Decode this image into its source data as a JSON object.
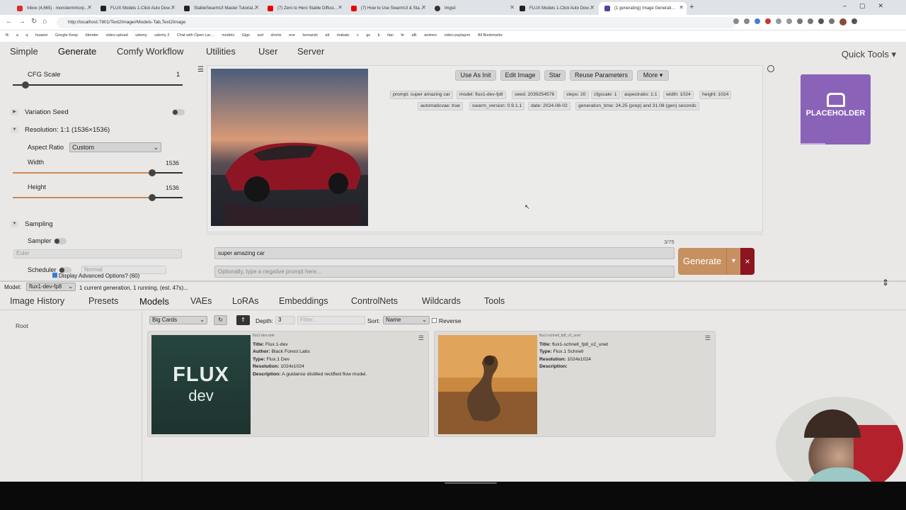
{
  "browser": {
    "tabs": [
      {
        "title": "Inbox (4,665) - monstermmorp…",
        "color": "#d93025"
      },
      {
        "title": "FLUX Models 1-Click Auto Dow…",
        "color": "#222"
      },
      {
        "title": "StableSwarmUI Master Tutorial…",
        "color": "#222"
      },
      {
        "title": "(7) Zero to Hero Stable Diffusi…",
        "color": "#e00"
      },
      {
        "title": "(7) How to Use SwarmUI & Sta…",
        "color": "#e00"
      },
      {
        "title": "Imgsli",
        "color": "#333"
      },
      {
        "title": "FLUX Models 1-Click Auto Dow…",
        "color": "#222"
      },
      {
        "title": "(1 generating) Image Generati…",
        "color": "#5a3fa0"
      }
    ],
    "url": "http://localhost:7801/Text2Image#Models-Tab,Text2Image",
    "bookmarks": [
      "fk",
      "a",
      "q",
      "huawei",
      "Google Keep",
      "blender",
      "video upload",
      "udemy",
      "udemy 2",
      "Chat with Open Lar…",
      "models",
      "Gigs",
      "ssd",
      "shorts",
      "eve",
      "leonardo",
      "alt",
      "makale",
      "c",
      "gs",
      "b",
      "ilan",
      "fe",
      "afk",
      "animex",
      "video paylaşım",
      "All Bookmarks"
    ]
  },
  "nav": {
    "tabs": [
      "Simple",
      "Generate",
      "Comfy Workflow",
      "Utilities",
      "User",
      "Server"
    ],
    "active": "Generate",
    "quick_tools": "Quick Tools"
  },
  "params": {
    "cfg_label": "CFG Scale",
    "cfg_value": "1",
    "variation_label": "Variation Seed",
    "resolution_label": "Resolution: 1:1 (1536×1536)",
    "aspect_label": "Aspect Ratio",
    "aspect_value": "Custom",
    "width_label": "Width",
    "width_value": "1536",
    "height_label": "Height",
    "height_value": "1536",
    "sampling_label": "Sampling",
    "sampler_label": "Sampler",
    "sampler_value": "Euler",
    "scheduler_label": "Scheduler",
    "scheduler_value": "Normal",
    "display_advanced": "Display Advanced Options? (60)"
  },
  "image_actions": [
    "Use As Init",
    "Edit Image",
    "Star",
    "Reuse Parameters",
    "More ▾"
  ],
  "metadata_row1": [
    "prompt: super amazing car",
    "model: flux1-dev-fp8",
    "seed: 2039254576",
    "steps: 20",
    "cfgscale: 1",
    "aspectratio: 1:1",
    "width: 1024",
    "height: 1024"
  ],
  "metadata_row2": [
    "automaticvae: true",
    "swarm_version: 0.9.1.1",
    "date: 2024-08-02",
    "generation_time: 24.25 (prep) and 31.08 (gen) seconds"
  ],
  "placeholder_text": "PLACEHOLDER",
  "prompt": {
    "counter": "3/75",
    "value": "super amazing car",
    "negative_placeholder": "Optionally, type a negative prompt here..."
  },
  "generate": {
    "label": "Generate",
    "dropdown": "▾",
    "cancel": "×"
  },
  "status": {
    "model_label": "Model:",
    "model_value": "flux1-dev-fp8",
    "text": "1 current generation, 1 running, (est. 47s)..."
  },
  "bottom_tabs": [
    "Image History",
    "Presets",
    "Models",
    "VAEs",
    "LoRAs",
    "Embeddings",
    "ControlNets",
    "Wildcards",
    "Tools"
  ],
  "bottom_active": "Models",
  "browser_panel": {
    "root": "Root",
    "view": "Big Cards",
    "depth_label": "Depth:",
    "depth_value": "3",
    "filter_placeholder": "Filter...",
    "sort_label": "Sort:",
    "sort_value": "Name",
    "reverse_label": "Reverse"
  },
  "models": [
    {
      "filename": "flux1-dev.safe",
      "title": "Flux.1-dev",
      "author": "Black Forest Labs",
      "type": "Flux.1 Dev",
      "resolution": "1024x1024",
      "description": "A guidance distilled rectified flow model.",
      "thumb_text_1": "FLUX",
      "thumb_text_2": "dev"
    },
    {
      "filename": "flux1-schnell_fp8_v2_unet",
      "title": "flux1-schnell_fp8_v2_unet",
      "author": "",
      "type": "Flux.1 Schnell",
      "resolution": "1024x1024",
      "description": ""
    }
  ],
  "labels": {
    "title": "Title:",
    "author": "Author:",
    "type": "Type:",
    "resolution": "Resolution:",
    "description": "Description:"
  }
}
